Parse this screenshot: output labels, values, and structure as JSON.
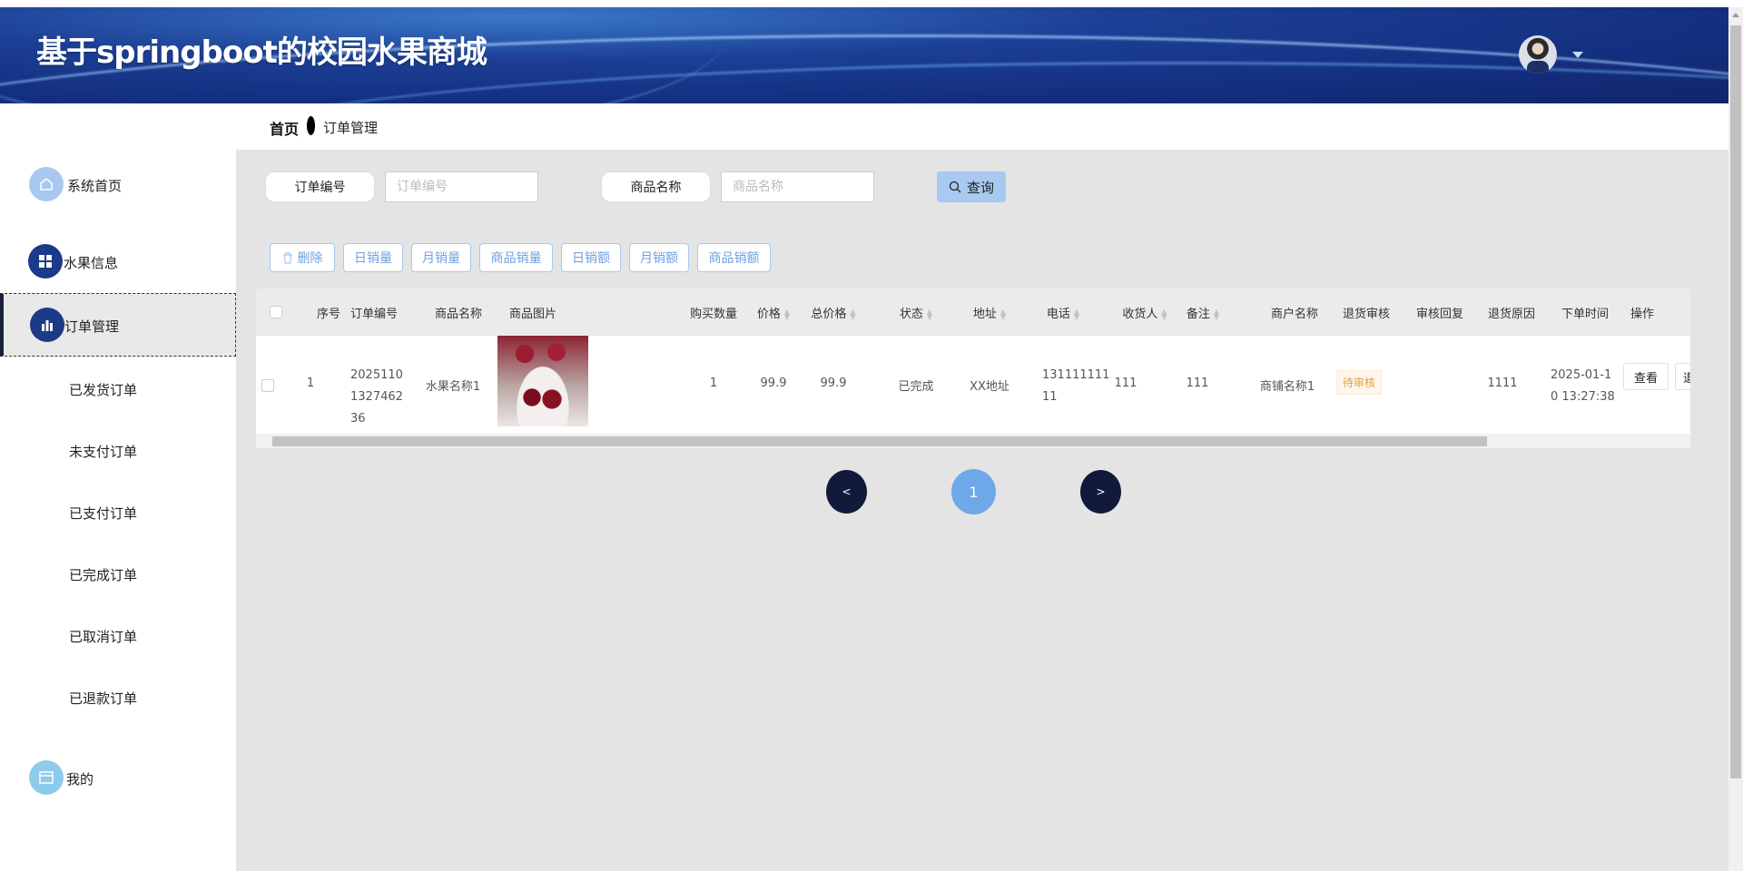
{
  "header": {
    "title": "基于springboot的校园水果商城",
    "avatar_icon": "user-avatar",
    "dropdown_icon": "caret-down-icon"
  },
  "sidebar": {
    "items": [
      {
        "label": "系统首页",
        "icon": "home-icon",
        "color": "#a9c8f0"
      },
      {
        "label": "水果信息",
        "icon": "grid-icon",
        "color": "#1b3a87"
      },
      {
        "label": "订单管理",
        "icon": "bar-chart-icon",
        "color": "#1b3a87",
        "active": true
      },
      {
        "label": "已发货订单"
      },
      {
        "label": "未支付订单"
      },
      {
        "label": "已支付订单"
      },
      {
        "label": "已完成订单"
      },
      {
        "label": "已取消订单"
      },
      {
        "label": "已退款订单"
      },
      {
        "label": "我的",
        "icon": "card-icon",
        "color": "#8ccbea"
      }
    ]
  },
  "breadcrumb": {
    "home": "首页",
    "current": "订单管理"
  },
  "search": {
    "order_no_label": "订单编号",
    "order_no_placeholder": "订单编号",
    "order_no_value": "",
    "product_label": "商品名称",
    "product_placeholder": "商品名称",
    "product_value": "",
    "query_label": "查询"
  },
  "toolbar": {
    "buttons": [
      "删除",
      "日销量",
      "月销量",
      "商品销量",
      "日销额",
      "月销额",
      "商品销额"
    ]
  },
  "table": {
    "columns": [
      "序号",
      "订单编号",
      "商品名称",
      "商品图片",
      "购买数量",
      "价格",
      "总价格",
      "状态",
      "地址",
      "电话",
      "收货人",
      "备注",
      "商户名称",
      "退货审核",
      "审核回复",
      "退货原因",
      "下单时间",
      "操作"
    ],
    "rows": [
      {
        "index": "1",
        "order_no": "2025110132746236",
        "product": "水果名称1",
        "image": "cherries",
        "qty": "1",
        "price": "99.9",
        "total": "99.9",
        "status": "已完成",
        "address": "XX地址",
        "phone": "13111111111",
        "receiver": "111",
        "remark": "111",
        "merchant": "商铺名称1",
        "return_review": "待审核",
        "review_reply": "",
        "return_reason": "1111",
        "order_time": "2025-01-10 13:27:38",
        "actions": [
          "查看",
          "退"
        ]
      }
    ]
  },
  "pagination": {
    "prev": "<",
    "current": "1",
    "next": ">",
    "active_color": "#6fa8e8",
    "nav_color": "#111a3a"
  }
}
